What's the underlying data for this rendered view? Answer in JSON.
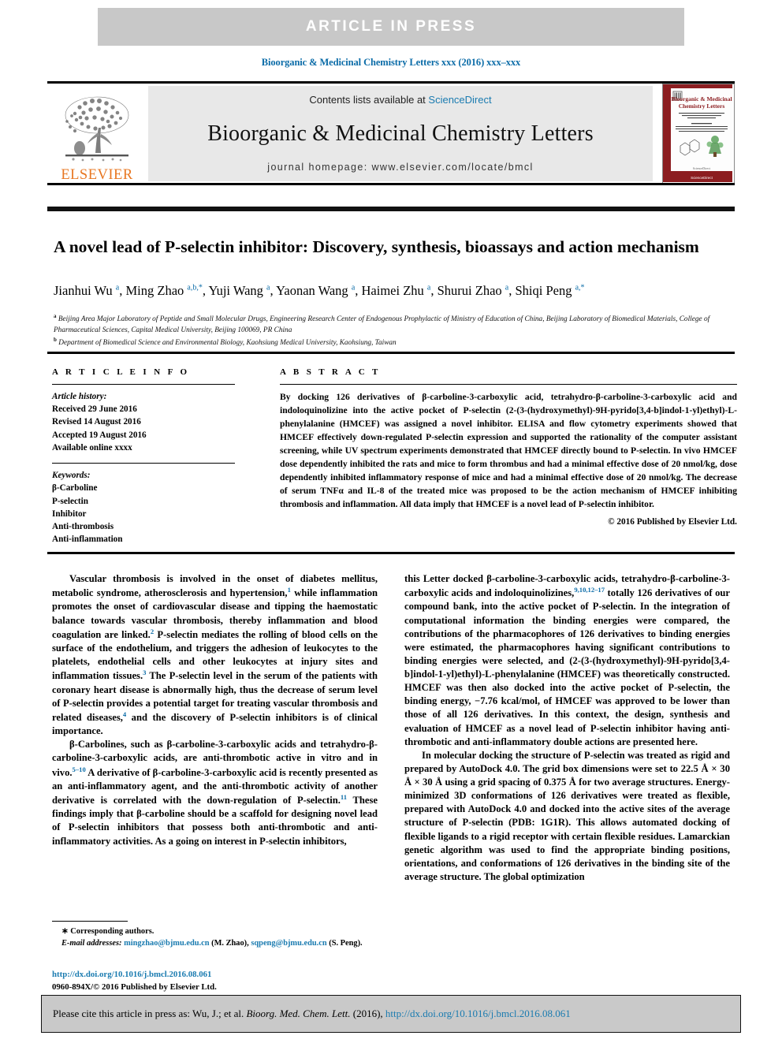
{
  "banner": {
    "label": "ARTICLE  IN  PRESS"
  },
  "running_head": "Bioorganic & Medicinal Chemistry Letters xxx (2016) xxx–xxx",
  "masthead": {
    "contents_prefix": "Contents lists available at ",
    "sciencedirect": "ScienceDirect",
    "journal_title": "Bioorganic & Medicinal Chemistry Letters",
    "homepage": "journal homepage: www.elsevier.com/locate/bmcl",
    "publisher_logo_text": "ELSEVIER",
    "cover": {
      "title_line1": "Bioorganic & Medicinal",
      "title_line2": "Chemistry Letters",
      "footer": "ScienceDirect"
    }
  },
  "article": {
    "title": "A novel lead of P-selectin inhibitor: Discovery, synthesis, bioassays and action mechanism",
    "authors_html": "Jianhui Wu <sup>a</sup>, Ming Zhao <sup>a,b,*</sup>, Yuji Wang <sup>a</sup>, Yaonan Wang <sup>a</sup>, Haimei Zhu <sup>a</sup>, Shurui Zhao <sup>a</sup>, Shiqi Peng <sup>a,*</sup>",
    "affiliation_a": "Beijing Area Major Laboratory of Peptide and Small Molecular Drugs, Engineering Research Center of Endogenous Prophylactic of Ministry of Education of China, Beijing Laboratory of Biomedical Materials, College of Pharmaceutical Sciences, Capital Medical University, Beijing 100069, PR China",
    "affiliation_b": "Department of Biomedical Science and Environmental Biology, Kaohsiung Medical University, Kaohsiung, Taiwan"
  },
  "article_info": {
    "heading": "A R T I C L E    I N F O",
    "history_label": "Article history:",
    "history": [
      "Received 29 June 2016",
      "Revised 14 August 2016",
      "Accepted 19 August 2016",
      "Available online xxxx"
    ],
    "keywords_label": "Keywords:",
    "keywords": [
      "β-Carboline",
      "P-selectin",
      "Inhibitor",
      "Anti-thrombosis",
      "Anti-inflammation"
    ]
  },
  "abstract": {
    "heading": "A B S T R A C T",
    "text": "By docking 126 derivatives of β-carboline-3-carboxylic acid, tetrahydro-β-carboline-3-carboxylic acid and indoloquinolizine into the active pocket of P-selectin (2-(3-(hydroxymethyl)-9H-pyrido[3,4-b]indol-1-yl)ethyl)-L-phenylalanine (HMCEF) was assigned a novel inhibitor. ELISA and flow cytometry experiments showed that HMCEF effectively down-regulated P-selectin expression and supported the rationality of the computer assistant screening, while UV spectrum experiments demonstrated that HMCEF directly bound to P-selectin. In vivo HMCEF dose dependently inhibited the rats and mice to form thrombus and had a minimal effective dose of 20 nmol/kg, dose dependently inhibited inflammatory response of mice and had a minimal effective dose of 20 nmol/kg. The decrease of serum TNFα and IL-8 of the treated mice was proposed to be the action mechanism of HMCEF inhibiting thrombosis and inflammation. All data imply that HMCEF is a novel lead of P-selectin inhibitor.",
    "copyright": "© 2016 Published by Elsevier Ltd."
  },
  "body": {
    "left_col": [
      {
        "indent": true,
        "html": "Vascular thrombosis is involved in the onset of diabetes mellitus, metabolic syndrome, atherosclerosis and hypertension,<sup>1</sup> while inflammation promotes the onset of cardiovascular disease and tipping the haemostatic balance towards vascular thrombosis, thereby inflammation and blood coagulation are linked.<sup>2</sup> P-selectin mediates the rolling of blood cells on the surface of the endothelium, and triggers the adhesion of leukocytes to the platelets, endothelial cells and other leukocytes at injury sites and inflammation tissues.<sup>3</sup> The P-selectin level in the serum of the patients with coronary heart disease is abnormally high, thus the decrease of serum level of P-selectin provides a potential target for treating vascular thrombosis and related diseases,<sup>4</sup> and the discovery of P-selectin inhibitors is of clinical importance."
      },
      {
        "indent": true,
        "html": "β-Carbolines, such as β-carboline-3-carboxylic acids and tetrahydro-β-carboline-3-carboxylic acids, are anti-thrombotic active in vitro and in vivo.<sup>5–10</sup> A derivative of β-carboline-3-carboxylic acid is recently presented as an anti-inflammatory agent, and the anti-thrombotic activity of another derivative is correlated with the down-regulation of P-selectin.<sup>11</sup> These findings imply that β-carboline should be a scaffold for designing novel lead of P-selectin inhibitors that possess both anti-thrombotic and anti-inflammatory activities. As a going on interest in P-selectin inhibitors,"
      }
    ],
    "right_col": [
      {
        "indent": false,
        "html": "this Letter docked β-carboline-3-carboxylic acids, tetrahydro-β-carboline-3-carboxylic acids and indoloquinolizines,<sup>9,10,12–17</sup> totally 126 derivatives of our compound bank, into the active pocket of P-selectin. In the integration of computational information the binding energies were compared, the contributions of the pharmacophores of 126 derivatives to binding energies were estimated, the pharmacophores having significant contributions to binding energies were selected, and (2-(3-(hydroxymethyl)-9H-pyrido[3,4-b]indol-1-yl)ethyl)-L-phenylalanine (HMCEF) was theoretically constructed. HMCEF was then also docked into the active pocket of P-selectin, the binding energy, −7.76 kcal/mol, of HMCEF was approved to be lower than those of all 126 derivatives. In this context, the design, synthesis and evaluation of HMCEF as a novel lead of P-selectin inhibitor having anti-thrombotic and anti-inflammatory double actions are presented here."
      },
      {
        "indent": true,
        "html": "In molecular docking the structure of P-selectin was treated as rigid and prepared by AutoDock 4.0. The grid box dimensions were set to 22.5 Å × 30 Å × 30 Å using a grid spacing of 0.375 Å for two average structures. Energy-minimized 3D conformations of 126 derivatives were treated as flexible, prepared with AutoDock 4.0 and docked into the active sites of the average structure of P-selectin (PDB: 1G1R). This allows automated docking of flexible ligands to a rigid receptor with certain flexible residues. Lamarckian genetic algorithm was used to find the appropriate binding positions, orientations, and conformations of 126 derivatives in the binding site of the average structure. The global optimization"
      }
    ]
  },
  "footnote": {
    "corresponding": "∗ Corresponding authors.",
    "email_label": "E-mail addresses:",
    "email1": "mingzhao@bjmu.edu.cn",
    "email1_attrib": "(M. Zhao),",
    "email2": "sqpeng@bjmu.edu.cn",
    "email2_attrib": "(S. Peng).",
    "doi": "http://dx.doi.org/10.1016/j.bmcl.2016.08.061",
    "issn": "0960-894X/© 2016 Published by Elsevier Ltd."
  },
  "cite_bar": {
    "prefix": "Please cite this article in press as: Wu, J.; et al. ",
    "journal": "Bioorg. Med. Chem. Lett.",
    "year": " (2016), ",
    "doi": "http://dx.doi.org/10.1016/j.bmcl.2016.08.061"
  },
  "colors": {
    "link": "#1a7bb0",
    "banner_bg": "#c8c8c8",
    "panel_bg": "#e8e8e8",
    "elsevier_orange": "#e87722",
    "runhead": "#0b6ca8"
  }
}
